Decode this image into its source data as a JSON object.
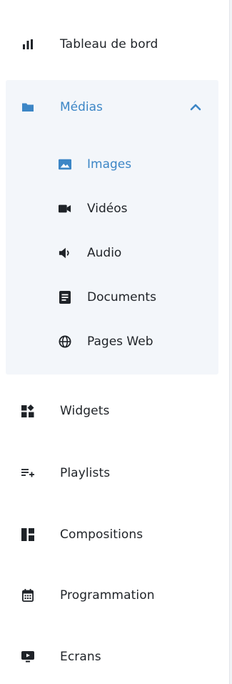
{
  "colors": {
    "accent": "#3c86c6",
    "text": "#1f2328",
    "group_bg": "#f3f6fa"
  },
  "nav": {
    "dashboard": {
      "label": "Tableau de bord",
      "icon": "bar-chart-icon"
    },
    "media": {
      "label": "Médias",
      "icon": "folder-icon",
      "expanded": true,
      "children": [
        {
          "label": "Images",
          "icon": "image-icon",
          "active": true
        },
        {
          "label": "Vidéos",
          "icon": "video-camera-icon"
        },
        {
          "label": "Audio",
          "icon": "speaker-icon"
        },
        {
          "label": "Documents",
          "icon": "document-icon"
        },
        {
          "label": "Pages Web",
          "icon": "globe-icon"
        }
      ]
    },
    "widgets": {
      "label": "Widgets",
      "icon": "widgets-icon"
    },
    "playlists": {
      "label": "Playlists",
      "icon": "playlist-add-icon"
    },
    "compositions": {
      "label": "Compositions",
      "icon": "layout-icon"
    },
    "scheduling": {
      "label": "Programmation",
      "icon": "calendar-icon"
    },
    "screens": {
      "label": "Ecrans",
      "icon": "monitor-icon"
    }
  }
}
